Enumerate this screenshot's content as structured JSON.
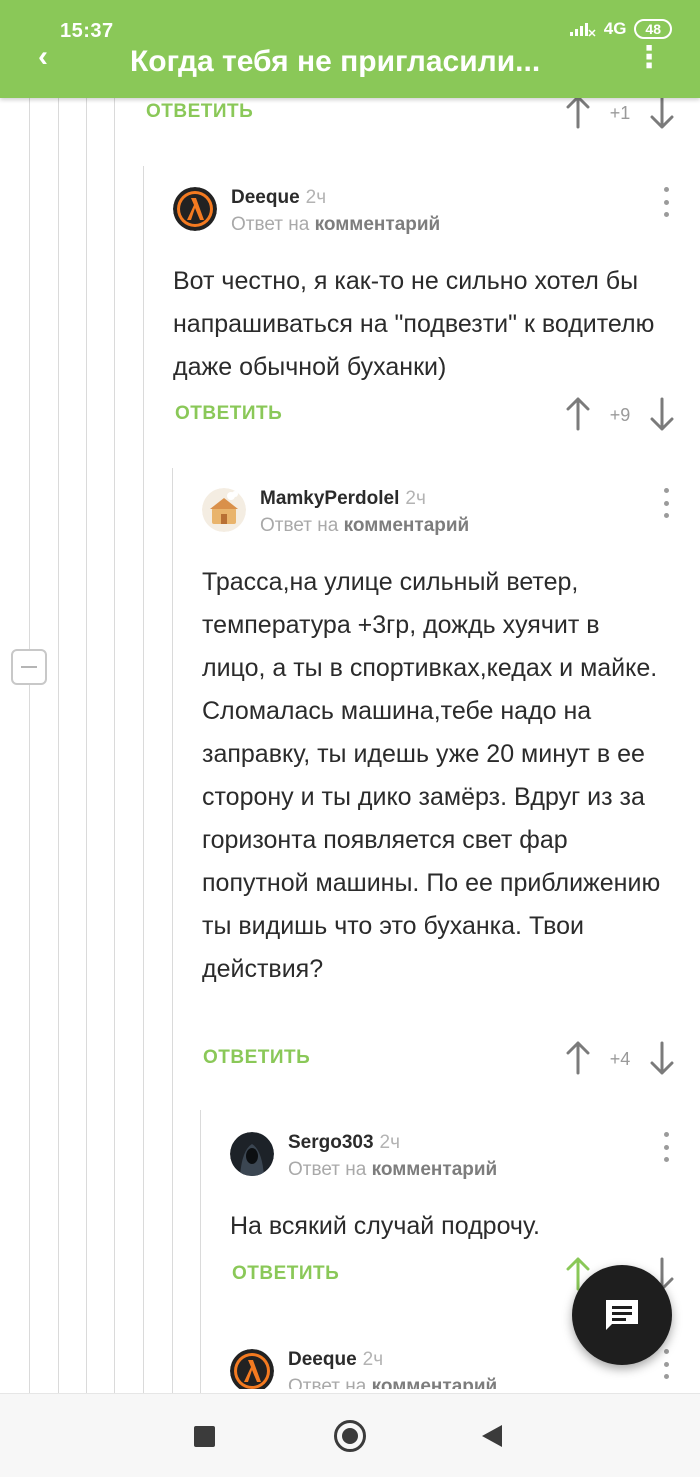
{
  "status_bar": {
    "time": "15:37",
    "network": "4G",
    "battery": "48"
  },
  "header": {
    "title": "Когда тебя не пригласили...",
    "back_icon": "back-arrow-icon",
    "menu_icon": "more-vert-icon"
  },
  "colors": {
    "accent": "#8ac858",
    "text": "#2b2b2b",
    "muted": "#a9a9a9",
    "fab": "#1e1e1e"
  },
  "top_actions": {
    "reply": "ОТВЕТИТЬ",
    "votes": "+1"
  },
  "comments": [
    {
      "author": "Deeque",
      "time": "2ч",
      "reply_prefix": "Ответ на",
      "reply_target": "комментарий",
      "avatar": "half-life-lambda-icon",
      "body": "Вот честно, я как-то не сильно хотел бы напрашиваться на \"подвезти\" к водителю даже обычной буханки)",
      "reply": "ОТВЕТИТЬ",
      "votes": "+9"
    },
    {
      "author": "MamkyPerdolel",
      "time": "2ч",
      "reply_prefix": "Ответ на",
      "reply_target": "комментарий",
      "avatar": "cartoon-house-avatar",
      "body": "Трасса,на улице сильный ветер, температура +3гр, дождь хуячит в лицо, а ты в спортивках,кедах и майке. Сломалась машина,тебе надо на заправку, ты идешь уже 20 минут в ее сторону и ты дико замёрз. Вдруг из за горизонта появляется свет фар попутной машины. По ее приближению ты видишь что это буханка. Твои действия?",
      "reply": "ОТВЕТИТЬ",
      "votes": "+4"
    },
    {
      "author": "Sergo303",
      "time": "2ч",
      "reply_prefix": "Ответ на",
      "reply_target": "комментарий",
      "avatar": "dark-hooded-figure-avatar",
      "body": "На всякий случай подрочу.",
      "reply": "ОТВЕТИТЬ",
      "votes": ""
    },
    {
      "author": "Deeque",
      "time": "2ч",
      "reply_prefix": "Ответ на",
      "reply_target": "комментарий",
      "avatar": "half-life-lambda-icon"
    }
  ],
  "fab": {
    "icon": "comment-icon"
  },
  "nav": {
    "recent_icon": "recent-apps-icon",
    "home_icon": "home-icon",
    "back_icon": "back-icon"
  }
}
